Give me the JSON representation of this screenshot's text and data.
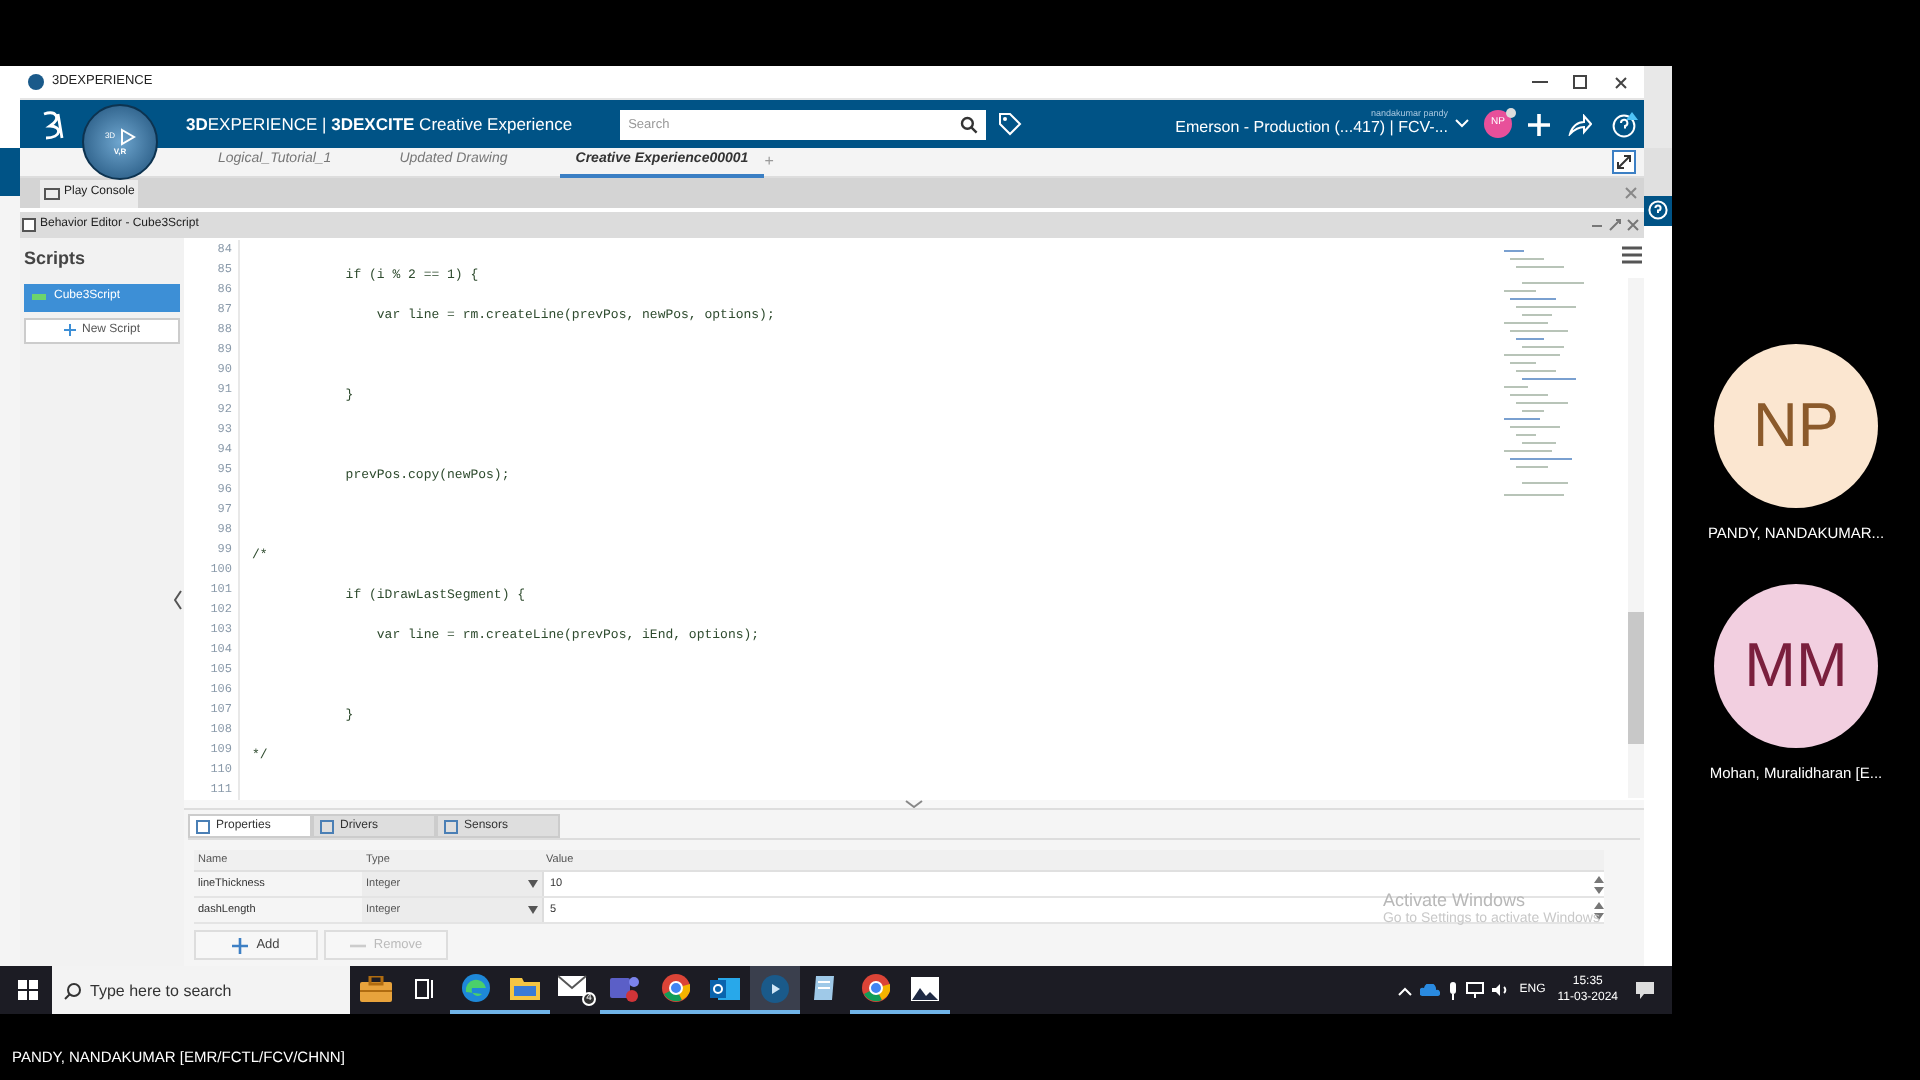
{
  "window": {
    "title": "3DEXPERIENCE"
  },
  "header": {
    "compass": {
      "left": "3D",
      "bottom": "V,R"
    },
    "brand": "**3D**EXPERIENCE | **3DEXCITE** Creative Experience",
    "search": {
      "placeholder": "Search"
    },
    "user": "nandakumar pandy",
    "tenant": "Emerson - Production (...417) | FCV-...",
    "avatar": "NP"
  },
  "tabs": [
    {
      "label": "Logical_Tutorial_1",
      "selected": false
    },
    {
      "label": "Updated Drawing",
      "selected": false
    },
    {
      "label": "Creative Experience00001",
      "selected": true
    }
  ],
  "add_tab": "+",
  "play_console": {
    "title": "Play Console"
  },
  "behavior_editor": {
    "title": "Behavior Editor - Cube3Script",
    "sidebar": {
      "heading": "Scripts",
      "scripts": [
        {
          "label": "Cube3Script",
          "selected": true
        }
      ],
      "new_button": "New Script"
    },
    "code": [
      {
        "number": "84"
      },
      {
        "number": "85",
        "text": "            if (i % 2 == 1) {"
      },
      {
        "number": "86"
      },
      {
        "number": "87",
        "text": "                var line = rm.createLine(prevPos, newPos, options);"
      },
      {
        "number": "88"
      },
      {
        "number": "89"
      },
      {
        "number": "90"
      },
      {
        "number": "91",
        "text": "            }"
      },
      {
        "number": "92"
      },
      {
        "number": "93"
      },
      {
        "number": "94"
      },
      {
        "number": "95",
        "text": "            prevPos.copy(newPos);"
      },
      {
        "number": "96"
      },
      {
        "number": "97"
      },
      {
        "number": "98"
      },
      {
        "number": "99",
        "text": "/*"
      },
      {
        "number": "100"
      },
      {
        "number": "101",
        "text": "            if (iDrawLastSegment) {"
      },
      {
        "number": "102"
      },
      {
        "number": "103",
        "text": "                var line = rm.createLine(prevPos, iEnd, options);"
      },
      {
        "number": "104"
      },
      {
        "number": "105"
      },
      {
        "number": "106"
      },
      {
        "number": "107",
        "text": "            }"
      },
      {
        "number": "108"
      },
      {
        "number": "109",
        "text": "*/"
      },
      {
        "number": "110"
      },
      {
        "number": "111"
      }
    ],
    "panel_tabs": [
      {
        "label": "Properties",
        "selected": true
      },
      {
        "label": "Drivers",
        "selected": false
      },
      {
        "label": "Sensors",
        "selected": false
      }
    ],
    "properties": {
      "columns": [
        "Name",
        "Type",
        "Value"
      ],
      "rows": [
        {
          "name": "lineThickness",
          "type": "Integer",
          "value": "10"
        },
        {
          "name": "dashLength",
          "type": "Integer",
          "value": "5"
        }
      ]
    },
    "add_button": {
      "label": "Add",
      "disabled": false
    },
    "remove_button": {
      "label": "Remove",
      "disabled": true
    }
  },
  "activation_notice": {
    "title": "Activate Windows",
    "text": "Go to Settings to activate Windows"
  },
  "taskbar": {
    "search_placeholder": "Type here to search",
    "apps": [
      {
        "kind": "briefcase",
        "running": false,
        "selected": false
      },
      {
        "kind": "taskview",
        "running": false,
        "selected": false
      },
      {
        "kind": "edge",
        "running": true,
        "selected": false
      },
      {
        "kind": "folder",
        "running": true,
        "selected": false
      },
      {
        "kind": "mail",
        "running": false,
        "selected": false,
        "badge": "4"
      },
      {
        "kind": "teams",
        "running": true,
        "selected": false
      },
      {
        "kind": "chrome",
        "running": true,
        "selected": false
      },
      {
        "kind": "outlook",
        "running": true,
        "selected": false
      },
      {
        "kind": "compass",
        "running": true,
        "selected": true
      },
      {
        "kind": "notes",
        "running": false,
        "selected": false
      },
      {
        "kind": "chrome",
        "running": true,
        "selected": false
      },
      {
        "kind": "photos",
        "running": true,
        "selected": false
      }
    ],
    "language": "ENG",
    "time": "15:35",
    "date": "11-03-2024"
  },
  "participants": [
    {
      "initials": "NP",
      "name": "PANDY, NANDAKUMAR...",
      "color": "#fbe6d0"
    },
    {
      "initials": "MM",
      "name": "Mohan, Muralidharan [E...",
      "color": "#f2cfe0"
    }
  ],
  "presenter": "PANDY, NANDAKUMAR [EMR/FCTL/FCV/CHNN]"
}
